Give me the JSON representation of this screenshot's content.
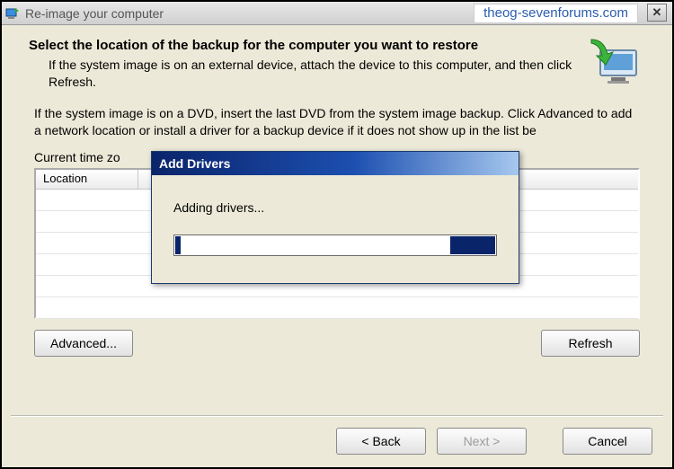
{
  "window": {
    "title": "Re-image your computer",
    "close_label": "✕"
  },
  "watermark": "theog-sevenforums.com",
  "header": {
    "heading": "Select the location of the backup for the computer you want to restore",
    "subheading": "If the system image is on an external device, attach the device to this computer, and then click Refresh."
  },
  "instruction": "If the system image is on a DVD, insert the last DVD from the system image backup. Click Advanced to add a network location or install a driver for a backup device if it does not show up in the list be",
  "current_tz_label": "Current time zo",
  "table": {
    "col_location": "Location"
  },
  "buttons": {
    "advanced": "Advanced...",
    "refresh": "Refresh",
    "back": "< Back",
    "next": "Next >",
    "cancel": "Cancel"
  },
  "modal": {
    "title": "Add Drivers",
    "status": "Adding drivers..."
  }
}
